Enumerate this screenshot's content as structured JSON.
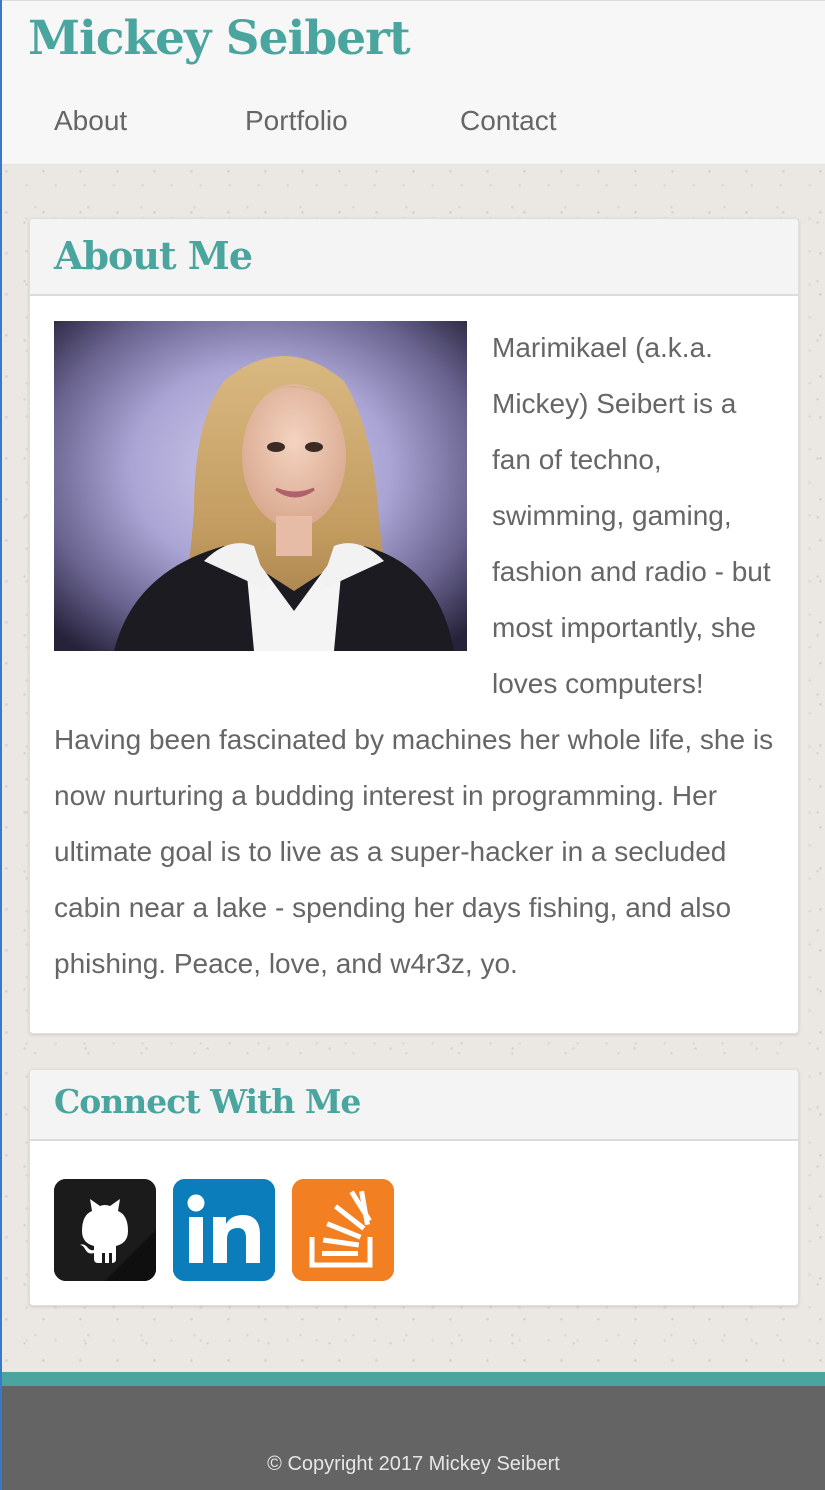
{
  "header": {
    "site_title": "Mickey Seibert",
    "nav": [
      {
        "label": "About"
      },
      {
        "label": "Portfolio"
      },
      {
        "label": "Contact"
      }
    ]
  },
  "about": {
    "heading": "About Me",
    "photo_alt": "Portrait of Mickey Seibert",
    "bio": "Marimikael (a.k.a. Mickey) Seibert is a fan of techno, swimming, gaming, fashion and radio - but most importantly, she loves computers! Having been fascinated by machines her whole life, she is now nurturing a budding interest in programming. Her ultimate goal is to live as a super-hacker in a secluded cabin near a lake - spending her days fishing, and also phishing. Peace, love, and w4r3z, yo."
  },
  "connect": {
    "heading": "Connect With Me",
    "links": [
      {
        "icon": "github-icon",
        "color": "#1b1b1b"
      },
      {
        "icon": "linkedin-icon",
        "color": "#0b7dbb"
      },
      {
        "icon": "stackoverflow-icon",
        "color": "#f27f22"
      }
    ]
  },
  "footer": {
    "copyright": "© Copyright 2017 Mickey Seibert"
  },
  "colors": {
    "accent": "#4aa59e",
    "footer_bg": "#646464",
    "text": "#666666"
  }
}
